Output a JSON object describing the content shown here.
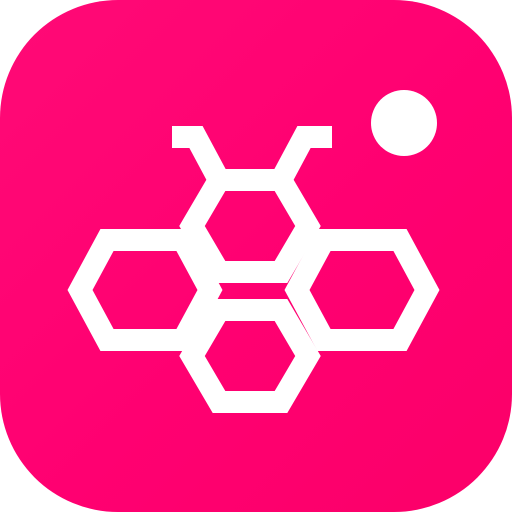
{
  "app_icon": {
    "name": "honeycomb-app-icon",
    "background_color": "#ff0071",
    "glyph_color": "#ffffff",
    "glyph": "honeycomb-bee-icon",
    "badge": "notification-dot-icon"
  }
}
